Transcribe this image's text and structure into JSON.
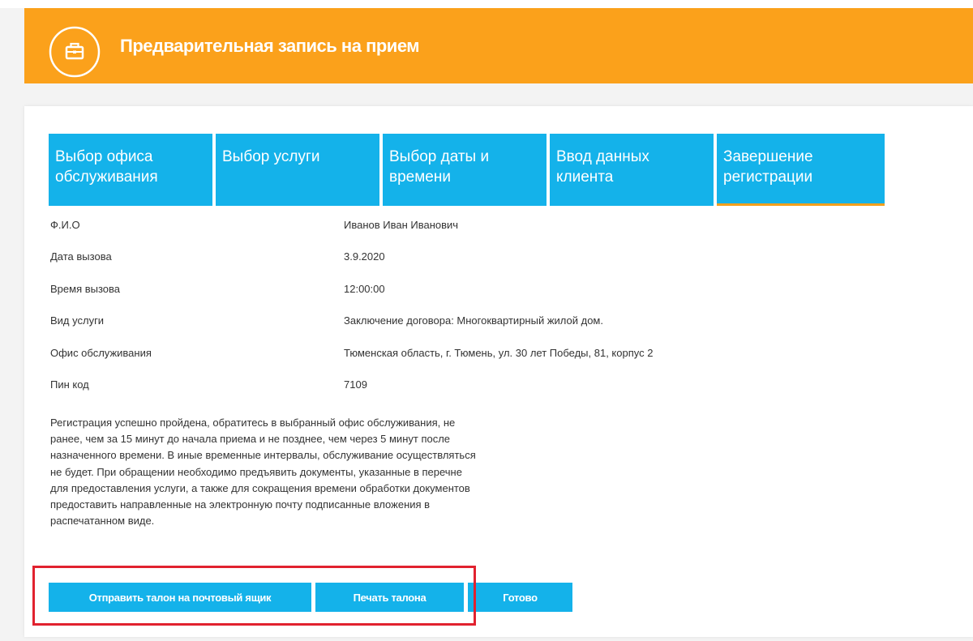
{
  "header": {
    "title": "Предварительная запись на прием",
    "icon": "briefcase-icon",
    "color": "#fba11b"
  },
  "steps": [
    {
      "label": "Выбор офиса\nобслуживания",
      "active": false
    },
    {
      "label": "Выбор услуги",
      "active": false
    },
    {
      "label": "Выбор даты и\nвремени",
      "active": false
    },
    {
      "label": "Ввод данных\nклиента",
      "active": false
    },
    {
      "label": "Завершение\nрегистрации",
      "active": true
    }
  ],
  "info": [
    {
      "label": "Ф.И.О",
      "value": "Иванов Иван Иванович"
    },
    {
      "label": "Дата вызова",
      "value": "3.9.2020"
    },
    {
      "label": "Время вызова",
      "value": "12:00:00"
    },
    {
      "label": "Вид услуги",
      "value": "Заключение договора: Многоквартирный жилой дом."
    },
    {
      "label": "Офис обслуживания",
      "value": "Тюменская область, г. Тюмень, ул. 30 лет Победы, 81, корпус 2"
    },
    {
      "label": "Пин код",
      "value": "7109"
    }
  ],
  "message": "Регистрация успешно пройдена, обратитесь в выбранный офис обслуживания, не ранее, чем за 15 минут до начала приема и не позднее, чем через 5 минут после назначенного времени. В иные временные интервалы, обслуживание осуществляться не будет. При обращении необходимо предъявить документы, указанные в перечне для предоставления услуги, а также для сокращения времени обработки документов предоставить направленные на электронную почту подписанные вложения в распечатанном виде.",
  "buttons": {
    "send": "Отправить талон на почтовый ящик",
    "print": "Печать талона",
    "done": "Готово"
  },
  "colors": {
    "accent": "#14b2ea",
    "active_underline": "#f2a01d",
    "highlight": "#e1222f"
  }
}
